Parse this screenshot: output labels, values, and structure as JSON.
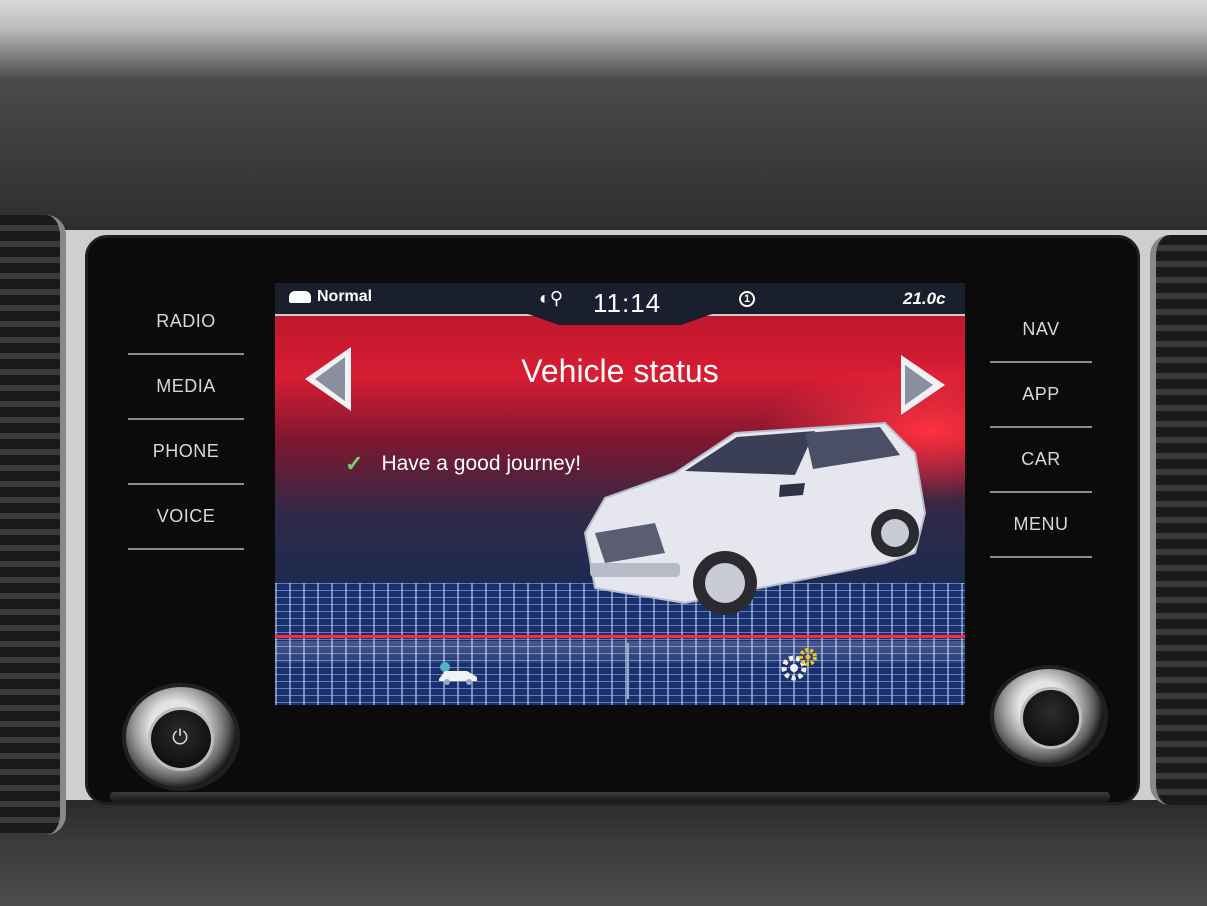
{
  "hard_keys_left": [
    {
      "label": "RADIO"
    },
    {
      "label": "MEDIA"
    },
    {
      "label": "PHONE"
    },
    {
      "label": "VOICE"
    }
  ],
  "hard_keys_right": [
    {
      "label": "NAV"
    },
    {
      "label": "APP"
    },
    {
      "label": "CAR"
    },
    {
      "label": "MENU"
    }
  ],
  "status_bar": {
    "mode_label": "Normal",
    "mode_icon": "car-mini-icon",
    "assist_icon": "driver-assist-icon",
    "clock": "11:14",
    "info_badge": "1",
    "temperature": "21.0c"
  },
  "screen": {
    "title": "Vehicle status",
    "prev_icon": "arrow-left-icon",
    "next_icon": "arrow-right-icon",
    "message": "Have a good journey!",
    "message_icon": "check-icon",
    "bottom_icons": [
      "car-status-icon",
      "settings-gear-icon"
    ]
  },
  "colors": {
    "accent_red": "#d81c33",
    "status_bar": "#1a1f2d",
    "check_green": "#6fd36f",
    "floor_blue": "#18306e"
  }
}
